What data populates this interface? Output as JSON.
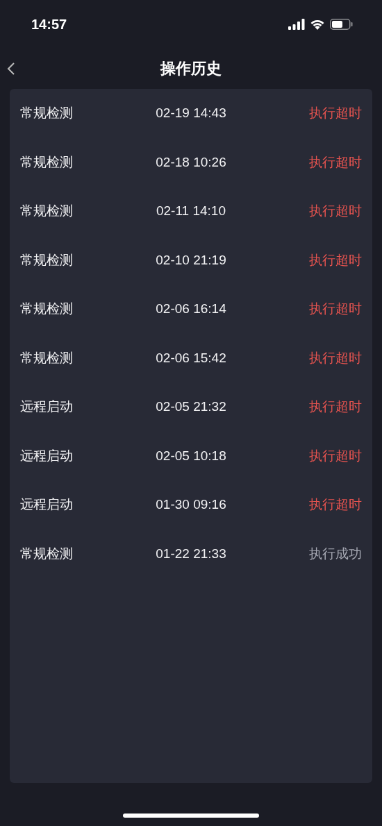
{
  "status_bar": {
    "time": "14:57"
  },
  "nav": {
    "title": "操作历史"
  },
  "history": [
    {
      "name": "常规检测",
      "time": "02-19 14:43",
      "status": "执行超时",
      "kind": "timeout"
    },
    {
      "name": "常规检测",
      "time": "02-18 10:26",
      "status": "执行超时",
      "kind": "timeout"
    },
    {
      "name": "常规检测",
      "time": "02-11 14:10",
      "status": "执行超时",
      "kind": "timeout"
    },
    {
      "name": "常规检测",
      "time": "02-10 21:19",
      "status": "执行超时",
      "kind": "timeout"
    },
    {
      "name": "常规检测",
      "time": "02-06 16:14",
      "status": "执行超时",
      "kind": "timeout"
    },
    {
      "name": "常规检测",
      "time": "02-06 15:42",
      "status": "执行超时",
      "kind": "timeout"
    },
    {
      "name": "远程启动",
      "time": "02-05 21:32",
      "status": "执行超时",
      "kind": "timeout"
    },
    {
      "name": "远程启动",
      "time": "02-05 10:18",
      "status": "执行超时",
      "kind": "timeout"
    },
    {
      "name": "远程启动",
      "time": "01-30 09:16",
      "status": "执行超时",
      "kind": "timeout"
    },
    {
      "name": "常规检测",
      "time": "01-22 21:33",
      "status": "执行成功",
      "kind": "success"
    }
  ]
}
